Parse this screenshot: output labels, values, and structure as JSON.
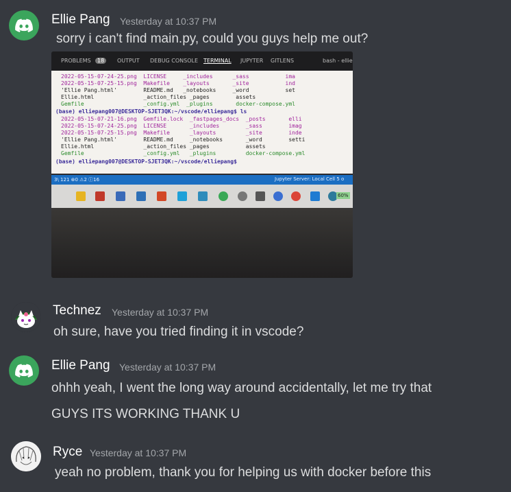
{
  "messages": [
    {
      "author": "Ellie Pang",
      "timestamp": "Yesterday at 10:37 PM",
      "lines": [
        "sorry i can't find main.py, could you guys help me out?"
      ],
      "avatar": "discord-default-avatar",
      "attachment": {
        "tabs": [
          "PROBLEMS",
          "18",
          "OUTPUT",
          "DEBUG CONSOLE",
          "TERMINAL",
          "JUPYTER",
          "GITLENS",
          "bash - ellie"
        ],
        "terminal_lines": [
          "2022-05-15-07-24-25.png  LICENSE     _includes      _sass           ima",
          "2022-05-15-07-25-15.png  Makefile    _layouts       _site           ind",
          "'Ellie Pang.html'        README.md   _notebooks     _word           set",
          "Ellie.html               _action_files _pages        assets",
          "Gemfile                  _config.yml  _plugins       docker-compose.yml",
          "(base) elliepang007@DESKTOP-SJET3QK:~/vscode/elliepang$ ls",
          "2022-05-15-07-21-16.png  Gemfile.lock  _fastpages_docs  _posts       elli",
          "2022-05-15-07-24-25.png  LICENSE       _includes        _sass        imag",
          "2022-05-15-07-25-15.png  Makefile      _layouts         _site        inde",
          "'Ellie Pang.html'        README.md     _notebooks       _word        setti",
          "Ellie.html               _action_files _pages           assets",
          "Gemfile                  _config.yml   _plugins         docker-compose.yml",
          "(base) elliepang007@DESKTOP-SJET3QK:~/vscode/elliepang$"
        ],
        "status_left": "3\\ 121   ⊗0 ⚠2 ⓘ16",
        "status_right": "Jupyter Server: Local   Cell 5 o",
        "battery": "60%"
      }
    },
    {
      "author": "Technez",
      "timestamp": "Yesterday at 10:37 PM",
      "lines": [
        "oh sure, have you tried finding it in vscode?"
      ],
      "avatar": "cat-watermelon-avatar"
    },
    {
      "author": "Ellie Pang",
      "timestamp": "Yesterday at 10:37 PM",
      "lines": [
        "ohhh yeah, I went the long way around accidentally, let me try that",
        "GUYS ITS WORKING THANK U"
      ],
      "avatar": "discord-default-avatar"
    },
    {
      "author": "Ryce",
      "timestamp": "Yesterday at 10:37 PM",
      "lines": [
        "yeah no problem, thank you for helping us with docker before this"
      ],
      "avatar": "anime-sketch-avatar"
    }
  ],
  "colors": {
    "background": "#36393f",
    "discord_green": "#3ba55c",
    "username": "#ffffff",
    "timestamp": "#a3a6aa",
    "text": "#dcddde"
  }
}
